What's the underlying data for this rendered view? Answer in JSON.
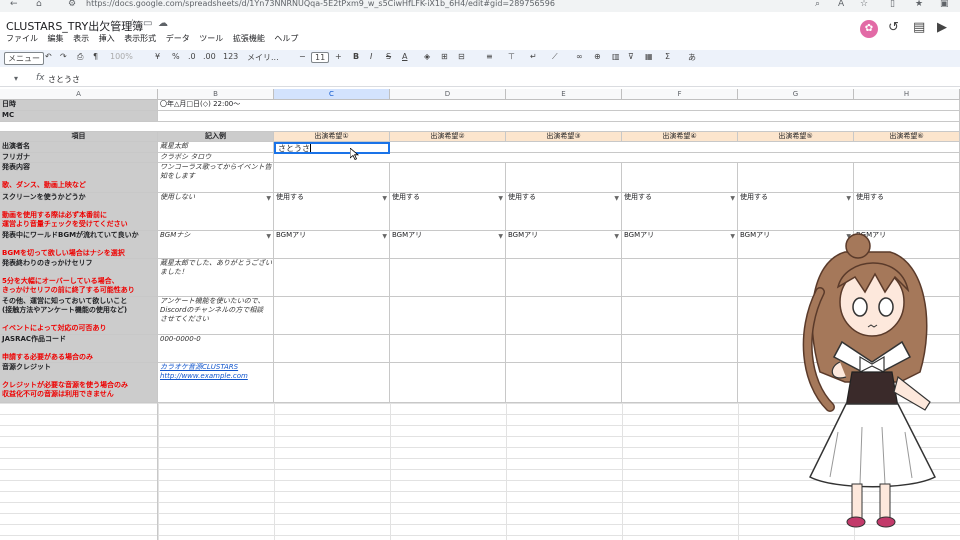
{
  "browser": {
    "url": "https://docs.google.com/spreadsheets/d/1Yn73NNRNUQqa-5E2tPxm9_w_s5CiwHfLFK-iX1b_6H4/edit#gid=289756596"
  },
  "doc": {
    "title": "CLUSTARS_TRY出欠管理簿"
  },
  "menu": [
    "ファイル",
    "編集",
    "表示",
    "挿入",
    "表示形式",
    "データ",
    "ツール",
    "拡張機能",
    "ヘルプ"
  ],
  "toolbar": {
    "menus_label": "メニュー",
    "zoom": "100%",
    "font": "メイリ...",
    "font_size": "11",
    "currency": "¥",
    "percent": "%",
    "dec_down": ".0",
    "dec_up": ".00",
    "num_format": "123",
    "input_tool": "あ"
  },
  "formula": {
    "cell_ref": "▾",
    "fx": "fx",
    "value": "さとうさ"
  },
  "columns": [
    "A",
    "B",
    "C",
    "D",
    "E",
    "F",
    "G",
    "H"
  ],
  "rows": {
    "datetime_label": "日時",
    "datetime_value": "〇年△月□日(◇) 22:00〜",
    "mc_label": "MC",
    "item_header": "項目",
    "example_header": "記入例",
    "slot_headers": [
      "出演希望①",
      "出演希望②",
      "出演希望③",
      "出演希望④",
      "出演希望⑤",
      "出演希望⑥"
    ],
    "performer_label": "出演者名",
    "performer_example": "蔵星太郎",
    "performer_input": "さとうさ",
    "furigana_label": "フリガナ",
    "furigana_example": "クラボシ タロウ",
    "content_label": "発表内容",
    "content_note": "歌、ダンス、動画上映など",
    "content_example_1": "ワンコーラス歌ってからイベント告",
    "content_example_2": "知をします",
    "screen_label": "スクリーンを使うかどうか",
    "screen_note_1": "動画を使用する際は必ず本番前に",
    "screen_note_2": "運営より音量チェックを受けてください",
    "screen_example": "使用しない",
    "screen_values": [
      "使用する",
      "使用する",
      "使用する",
      "使用する",
      "使用する",
      "使用する"
    ],
    "bgm_label": "発表中にワールドBGMが流れていて良いか",
    "bgm_note": "BGMを切って欲しい場合はナシを選択",
    "bgm_example": "BGMナシ",
    "bgm_values": [
      "BGMアリ",
      "BGMアリ",
      "BGMアリ",
      "BGMアリ",
      "BGMアリ",
      "BGMアリ"
    ],
    "cue_label": "発表終わりのきっかけセリフ",
    "cue_note_1": "5分を大幅にオーバーしている場合、",
    "cue_note_2": "きっかけセリフの前に終了する可能性あり",
    "cue_example_1": "蔵星太郎でした、ありがとうござい",
    "cue_example_2": "ました！",
    "other_label_1": "その他、運営に知っておいて欲しいこと",
    "other_label_2": "(接触方法やアンケート機能の使用など)",
    "other_note": "イベントによって対応の可否あり",
    "other_example_1": "アンケート機能を使いたいので、",
    "other_example_2": "Discordのチャンネルの方で相談",
    "other_example_3": "させてください",
    "jasrac_label": "JASRAC作品コード",
    "jasrac_note": "申請する必要がある場合のみ",
    "jasrac_example": "000-0000-0",
    "credit_label": "音源クレジット",
    "credit_note_1": "クレジットが必要な音源を使う場合のみ",
    "credit_note_2": "収益化不可の音源は利用できません",
    "credit_example_1": "カラオケ音源CLUSTARS",
    "credit_example_2": "http://www.example.com"
  },
  "colors": {
    "peach": "#fce5cd",
    "gray": "#cccccc",
    "red": "#ee0000",
    "accent": "#1a73e8"
  }
}
